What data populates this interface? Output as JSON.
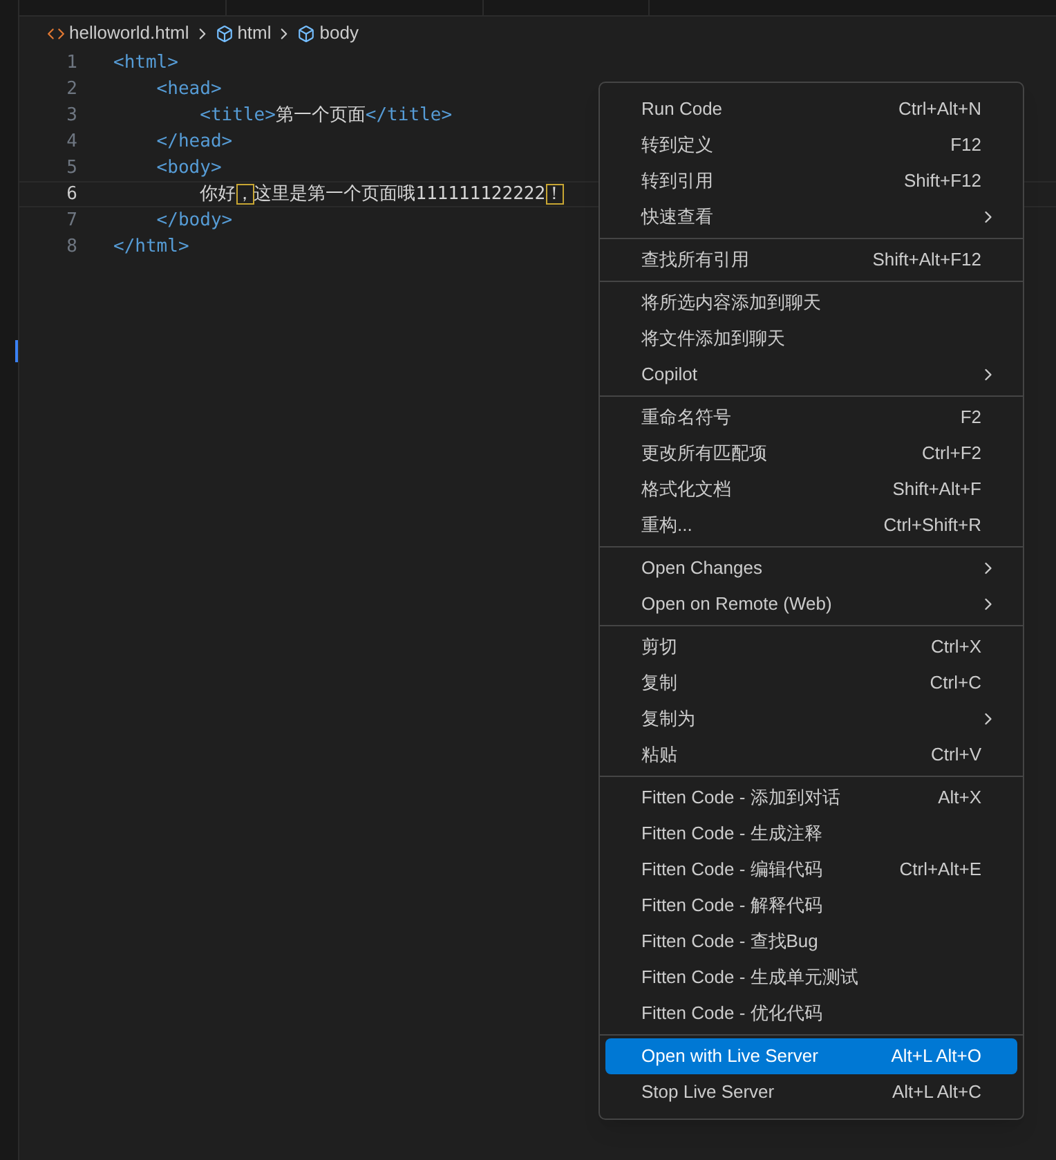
{
  "breadcrumb": [
    {
      "kind": "file",
      "label": "helloworld.html"
    },
    {
      "kind": "element",
      "label": "html"
    },
    {
      "kind": "element",
      "label": "body"
    }
  ],
  "code": [
    {
      "number": "1",
      "current": false,
      "tokens": [
        {
          "kind": "tag",
          "text": "<html>"
        }
      ]
    },
    {
      "number": "2",
      "current": false,
      "tokens": [
        {
          "kind": "tag",
          "text": "    <head>"
        }
      ]
    },
    {
      "number": "3",
      "current": false,
      "tokens": [
        {
          "kind": "tag",
          "text": "        <title>"
        },
        {
          "kind": "text",
          "text": "第一个页面"
        },
        {
          "kind": "tag",
          "text": "</title>"
        }
      ]
    },
    {
      "number": "4",
      "current": false,
      "tokens": [
        {
          "kind": "tag",
          "text": "    </head>"
        }
      ]
    },
    {
      "number": "5",
      "current": false,
      "tokens": [
        {
          "kind": "tag",
          "text": "    <body>"
        }
      ]
    },
    {
      "number": "6",
      "current": true,
      "tokens": [
        {
          "kind": "text",
          "text": "        你好"
        },
        {
          "kind": "match",
          "text": "，"
        },
        {
          "kind": "text",
          "text": "这里是第一个页面哦111111122222"
        },
        {
          "kind": "match",
          "text": "！"
        }
      ]
    },
    {
      "number": "7",
      "current": false,
      "tokens": [
        {
          "kind": "tag",
          "text": "    </body>"
        }
      ]
    },
    {
      "number": "8",
      "current": false,
      "tokens": [
        {
          "kind": "tag",
          "text": "</html>"
        }
      ]
    }
  ],
  "context_menu": [
    [
      {
        "label": "Run Code",
        "shortcut": "Ctrl+Alt+N",
        "submenu": false,
        "selected": false
      },
      {
        "label": "转到定义",
        "shortcut": "F12",
        "submenu": false,
        "selected": false
      },
      {
        "label": "转到引用",
        "shortcut": "Shift+F12",
        "submenu": false,
        "selected": false
      },
      {
        "label": "快速查看",
        "submenu": true,
        "selected": false
      }
    ],
    [
      {
        "label": "查找所有引用",
        "shortcut": "Shift+Alt+F12",
        "submenu": false,
        "selected": false
      }
    ],
    [
      {
        "label": "将所选内容添加到聊天",
        "submenu": false,
        "selected": false
      },
      {
        "label": "将文件添加到聊天",
        "submenu": false,
        "selected": false
      },
      {
        "label": "Copilot",
        "submenu": true,
        "selected": false
      }
    ],
    [
      {
        "label": "重命名符号",
        "shortcut": "F2",
        "submenu": false,
        "selected": false
      },
      {
        "label": "更改所有匹配项",
        "shortcut": "Ctrl+F2",
        "submenu": false,
        "selected": false
      },
      {
        "label": "格式化文档",
        "shortcut": "Shift+Alt+F",
        "submenu": false,
        "selected": false
      },
      {
        "label": "重构...",
        "shortcut": "Ctrl+Shift+R",
        "submenu": false,
        "selected": false
      }
    ],
    [
      {
        "label": "Open Changes",
        "submenu": true,
        "selected": false
      },
      {
        "label": "Open on Remote (Web)",
        "submenu": true,
        "selected": false
      }
    ],
    [
      {
        "label": "剪切",
        "shortcut": "Ctrl+X",
        "submenu": false,
        "selected": false
      },
      {
        "label": "复制",
        "shortcut": "Ctrl+C",
        "submenu": false,
        "selected": false
      },
      {
        "label": "复制为",
        "submenu": true,
        "selected": false
      },
      {
        "label": "粘贴",
        "shortcut": "Ctrl+V",
        "submenu": false,
        "selected": false
      }
    ],
    [
      {
        "label": "Fitten Code - 添加到对话",
        "shortcut": "Alt+X",
        "submenu": false,
        "selected": false
      },
      {
        "label": "Fitten Code - 生成注释",
        "submenu": false,
        "selected": false
      },
      {
        "label": "Fitten Code - 编辑代码",
        "shortcut": "Ctrl+Alt+E",
        "submenu": false,
        "selected": false
      },
      {
        "label": "Fitten Code - 解释代码",
        "submenu": false,
        "selected": false
      },
      {
        "label": "Fitten Code - 查找Bug",
        "submenu": false,
        "selected": false
      },
      {
        "label": "Fitten Code - 生成单元测试",
        "submenu": false,
        "selected": false
      },
      {
        "label": "Fitten Code - 优化代码",
        "submenu": false,
        "selected": false
      }
    ],
    [
      {
        "label": "Open with Live Server",
        "shortcut": "Alt+L Alt+O",
        "submenu": false,
        "selected": true
      },
      {
        "label": "Stop Live Server",
        "shortcut": "Alt+L Alt+C",
        "submenu": false,
        "selected": false
      }
    ]
  ]
}
